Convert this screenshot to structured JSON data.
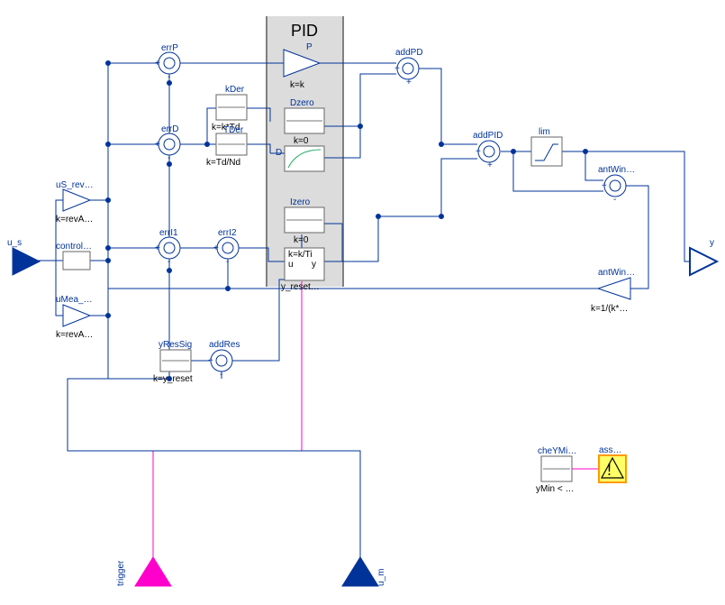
{
  "title": "PID",
  "ports": {
    "u_s": "u_s",
    "y": "y",
    "trigger": "trigger",
    "u_m": "u_m"
  },
  "blocks": {
    "errP": {
      "label": "errP"
    },
    "errD": {
      "label": "errD"
    },
    "errI1": {
      "label": "errI1"
    },
    "errI2": {
      "label": "errI2"
    },
    "kDer": {
      "label": "kDer",
      "caption": "k=k*Td"
    },
    "TDer": {
      "label": "TDer",
      "caption": "k=Td/Nd"
    },
    "P": {
      "label": "P",
      "caption": "k=k"
    },
    "Dzero": {
      "label": "Dzero",
      "caption": "k=0"
    },
    "D": {
      "label": "D"
    },
    "Izero": {
      "label": "Izero",
      "caption": "k=0"
    },
    "Iblk": {
      "label1": "k=k/Ti",
      "label2": "u",
      "label3": "y",
      "caption": "y_reset…"
    },
    "addPD": {
      "label": "addPD"
    },
    "addPID": {
      "label": "addPID"
    },
    "lim": {
      "label": "lim"
    },
    "antWin1": {
      "label": "antWin…"
    },
    "antWin2": {
      "label": "antWin…",
      "caption": "k=1/(k*…"
    },
    "uS_rev": {
      "label": "uS_rev…",
      "caption": "k=revA…"
    },
    "control": {
      "label": "control…"
    },
    "uMea": {
      "label": "uMea_…",
      "caption": "k=revA…"
    },
    "yResSig": {
      "label": "yResSig",
      "caption": "k=y_reset"
    },
    "addRes": {
      "label": "addRes"
    },
    "cheYMi": {
      "label": "cheYMi…",
      "caption": "yMin < …"
    },
    "ass": {
      "label": "ass…"
    }
  }
}
